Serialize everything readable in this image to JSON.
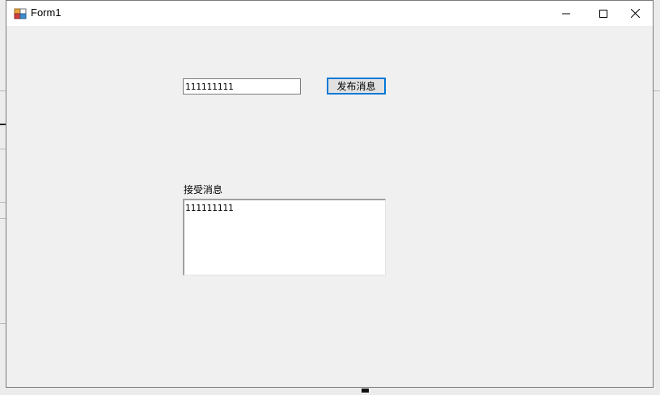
{
  "window": {
    "title": "Form1",
    "caption_buttons": {
      "minimize": "minimize-icon",
      "maximize": "maximize-icon",
      "close": "close-icon"
    }
  },
  "form": {
    "publish_input_value": "111111111",
    "publish_button_label": "发布消息",
    "receive_label": "接受消息",
    "receive_textarea_value": "111111111"
  },
  "colors": {
    "focus_border": "#0078d7",
    "form_background": "#f0f0f0",
    "titlebar": "#ffffff"
  }
}
